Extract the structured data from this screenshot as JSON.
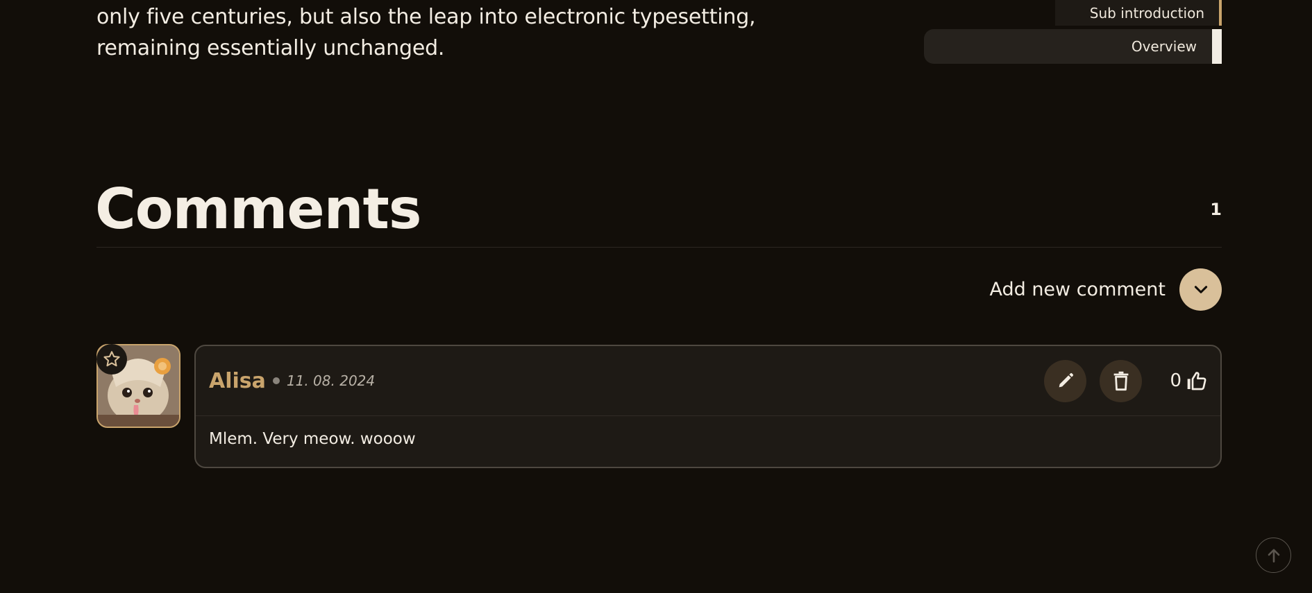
{
  "article": {
    "text_lines": [
      "only five centuries, but also the leap into electronic typesetting,",
      "remaining essentially unchanged."
    ]
  },
  "toc": {
    "items": [
      {
        "label": "Sub introduction"
      },
      {
        "label": "Overview",
        "active": true
      }
    ]
  },
  "comments": {
    "title": "Comments",
    "count": "1",
    "add_label": "Add new comment",
    "items": [
      {
        "author": "Alisa",
        "date": "11. 08. 2024",
        "likes": "0",
        "body": "Mlem. Very meow. wooow"
      }
    ]
  },
  "colors": {
    "background": "#120e09",
    "accent": "#c9a46c",
    "button_light": "#d9c09a",
    "card": "#1e1a15"
  },
  "icons": {
    "add_toggle": "chevron-down-icon",
    "edit": "pencil-icon",
    "delete": "trash-icon",
    "like": "thumbs-up-icon",
    "badge": "star-icon",
    "back_to_top": "arrow-up-icon"
  }
}
